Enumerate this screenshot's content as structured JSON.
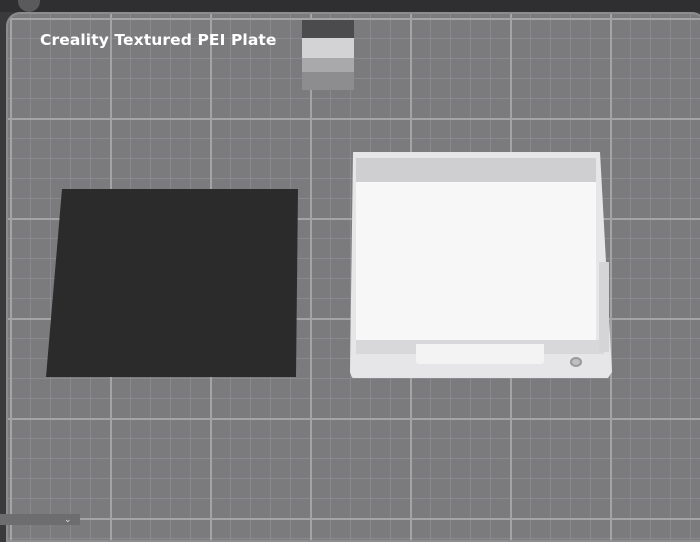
{
  "viewport": {
    "plate_label": "Creality Textured PEI Plate"
  },
  "icons": {
    "corner": "chevron-down-icon"
  },
  "colors": {
    "plate": "#7b7b7e",
    "grid_major": "#a4a4a7",
    "object_dark": "#2b2b2b",
    "object_light": "#f7f7f8"
  }
}
